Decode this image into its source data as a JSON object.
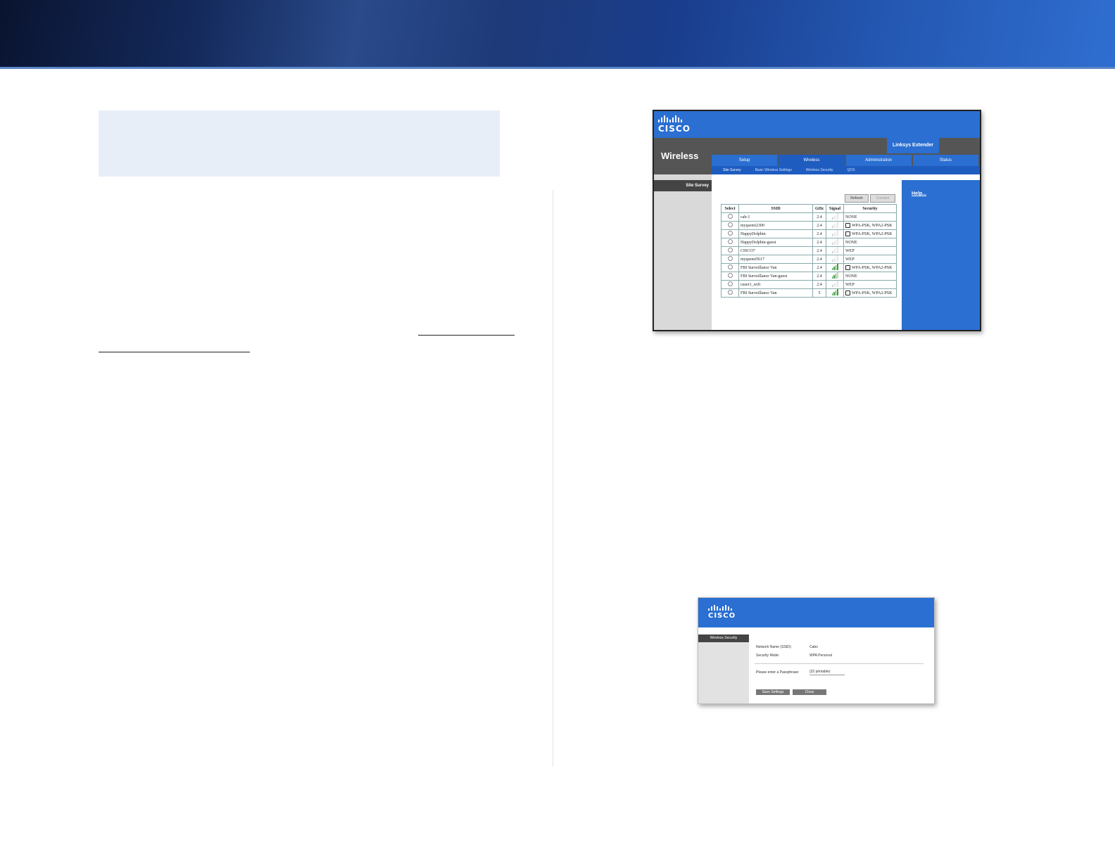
{
  "colors": {
    "accent": "#2a6fd1",
    "banner_dark": "#0a1430",
    "note_bg": "#e8eef8"
  },
  "screenshot1": {
    "brand": "CISCO",
    "section": "Wireless",
    "product": "Linksys Extender",
    "tabs": [
      {
        "label": "Setup"
      },
      {
        "label": "Wireless"
      },
      {
        "label": "Administration"
      },
      {
        "label": "Status"
      }
    ],
    "subtabs": [
      {
        "label": "Site Survey"
      },
      {
        "label": "Basic Wireless Settings"
      },
      {
        "label": "Wireless Security"
      },
      {
        "label": "QOS"
      }
    ],
    "side_header": "Site Survey",
    "refresh_label": "Refresh",
    "connect_label": "Connect",
    "help_label": "Help...",
    "columns": {
      "select": "Select",
      "ssid": "SSID",
      "ghz": "GHz",
      "signal": "Signal",
      "security": "Security"
    },
    "rows": [
      {
        "ssid": "cab-1",
        "ghz": "2.4",
        "signal_bars": 1,
        "security": "NONE",
        "locked": false
      },
      {
        "ssid": "myqsemi2300",
        "ghz": "2.4",
        "signal_bars": 1,
        "security": "WPA-PSK, WPA2-PSK",
        "locked": true
      },
      {
        "ssid": "HappyDolphin",
        "ghz": "2.4",
        "signal_bars": 1,
        "security": "WPA-PSK, WPA2-PSK",
        "locked": true
      },
      {
        "ssid": "HappyDolphin-guest",
        "ghz": "2.4",
        "signal_bars": 1,
        "security": "NONE",
        "locked": false
      },
      {
        "ssid": "CISCO7",
        "ghz": "2.4",
        "signal_bars": 1,
        "security": "WEP",
        "locked": false
      },
      {
        "ssid": "myqsemi5617",
        "ghz": "2.4",
        "signal_bars": 1,
        "security": "WEP",
        "locked": false
      },
      {
        "ssid": "FBI Surveillance Van",
        "ghz": "2.4",
        "signal_bars": 4,
        "security": "WPA-PSK, WPA2-PSK",
        "locked": true
      },
      {
        "ssid": "FBI Surveillance Van-guest",
        "ghz": "2.4",
        "signal_bars": 3,
        "security": "NONE",
        "locked": false
      },
      {
        "ssid": "cuser1_wifi",
        "ghz": "2.4",
        "signal_bars": 1,
        "security": "WEP",
        "locked": false
      },
      {
        "ssid": "FBI Surveillance Van",
        "ghz": "5",
        "signal_bars": 4,
        "security": "WPA-PSK, WPA2-PSK",
        "locked": true
      }
    ]
  },
  "screenshot2": {
    "brand": "CISCO",
    "side_header": "Wireless Security",
    "network_name_label": "Network Name (SSID):",
    "network_name_value": "Cabo",
    "security_mode_label": "Security Mode:",
    "security_mode_value": "WPA Personal",
    "passphrase_label": "Please enter a Passphrase:",
    "passphrase_value": "(32 printable)",
    "save_label": "Save Settings",
    "close_label": "Close"
  }
}
